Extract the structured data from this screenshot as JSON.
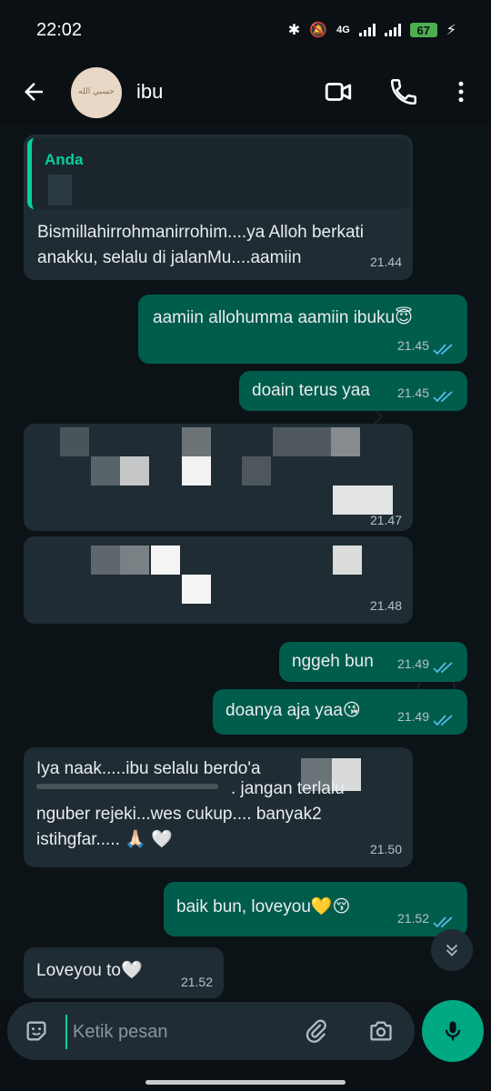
{
  "status_bar": {
    "time": "22:02",
    "network": "4G",
    "battery": "67"
  },
  "header": {
    "contact_name": "ibu",
    "avatar_caption": "حسبي الله",
    "back_icon": "arrow-left-icon",
    "video_icon": "video-call-icon",
    "call_icon": "phone-icon",
    "menu_icon": "more-vert-icon"
  },
  "messages": [
    {
      "direction": "in",
      "reply_to": "Anda",
      "text": "Bismillahirrohmanirrohim....ya Alloh berkati anakku, selalu di jalanMu....aamiin",
      "time": "21.44"
    },
    {
      "direction": "out",
      "text": "aamiin allohumma aamiin ibuku😇",
      "time": "21.45",
      "status": "read"
    },
    {
      "direction": "out",
      "text": "doain terus yaa",
      "time": "21.45",
      "status": "read"
    },
    {
      "direction": "in",
      "text": "",
      "time": "21.47",
      "censored": true
    },
    {
      "direction": "in",
      "text": "",
      "time": "21.48",
      "censored": true
    },
    {
      "direction": "out",
      "text": "nggeh bun",
      "time": "21.49",
      "status": "read"
    },
    {
      "direction": "out",
      "text": "doanya aja yaa😘",
      "time": "21.49",
      "status": "read"
    },
    {
      "direction": "in",
      "line1": "Iya naak.....ibu selalu berdo'a",
      "line2": ". jangan terlalu",
      "line3": "nguber rejeki...wes cukup.... banyak2",
      "line4": "istihgfar..... 🙏🏻 🤍",
      "time": "21.50"
    },
    {
      "direction": "out",
      "text": "baik bun, loveyou💛😚",
      "time": "21.52",
      "status": "read"
    },
    {
      "direction": "in",
      "text": "Loveyou to🤍",
      "time": "21.52"
    }
  ],
  "composer": {
    "placeholder": "Ketik pesan",
    "sticker_icon": "sticker-icon",
    "attach_icon": "paperclip-icon",
    "camera_icon": "camera-icon",
    "mic_icon": "mic-icon"
  },
  "colors": {
    "incoming_bubble": "#1f2c33",
    "outgoing_bubble": "#005c4b",
    "accent": "#00a884",
    "read_ticks": "#53bdeb"
  }
}
